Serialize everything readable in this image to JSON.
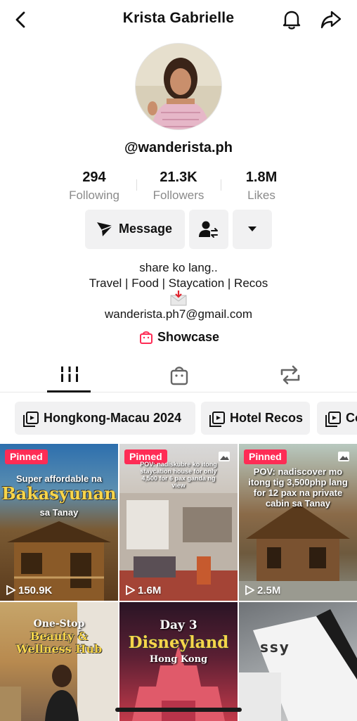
{
  "header": {
    "title": "Krista Gabrielle",
    "back_icon": "chevron-left-icon",
    "notify_icon": "bell-icon",
    "share_icon": "share-arrow-icon"
  },
  "profile": {
    "handle": "@wanderista.ph",
    "stats": [
      {
        "value": "294",
        "label": "Following"
      },
      {
        "value": "21.3K",
        "label": "Followers"
      },
      {
        "value": "1.8M",
        "label": "Likes"
      }
    ],
    "message_label": "Message",
    "bio_line1": "share ko lang..",
    "bio_line2": "Travel | Food | Staycation | Recos",
    "bio_email": "wanderista.ph7@gmail.com",
    "showcase_label": "Showcase"
  },
  "tabs": [
    "videos-grid-icon",
    "shop-bag-icon",
    "repost-icon"
  ],
  "playlists": [
    {
      "label": "Hongkong-Macau 2024"
    },
    {
      "label": "Hotel Recos"
    },
    {
      "label": "Co"
    }
  ],
  "videos": [
    {
      "pinned": "Pinned",
      "views": "150.9K",
      "title": "Bakasyunan",
      "pre": "Super affordable na",
      "sub": "sa Tanay"
    },
    {
      "pinned": "Pinned",
      "views": "1.6M",
      "caption": "POV: nadiskubre ko itong staycation house for only 4,500 for 6 pax ganda ng view"
    },
    {
      "pinned": "Pinned",
      "views": "2.5M",
      "caption": "POV: nadiscover mo itong tig 3,500php lang for 12 pax na private cabin sa Tanay"
    },
    {
      "pre": "One-Stop",
      "title": "Beauty & Wellness Hub"
    },
    {
      "pre": "Day 3",
      "title": "Disneyland",
      "sub": "Hong Kong"
    },
    {
      "brand": "ssy"
    }
  ],
  "colors": {
    "accent": "#fe2c55",
    "button_bg": "#f1f1f2"
  }
}
